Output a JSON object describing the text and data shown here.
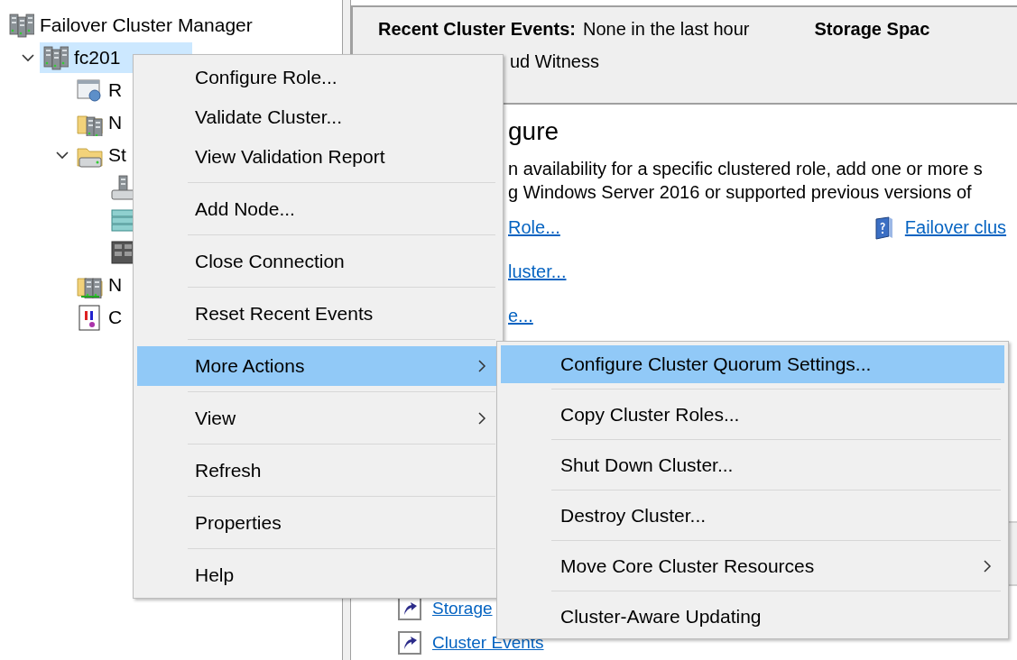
{
  "tree": {
    "items": [
      {
        "label": "Failover Cluster Manager",
        "kind": "manager",
        "selected": false,
        "children": [
          {
            "label": "fc201",
            "kind": "cluster",
            "selected": true,
            "expanded": true,
            "children": [
              {
                "label": "R",
                "kind": "roles",
                "selected": false
              },
              {
                "label": "N",
                "kind": "nodes",
                "selected": false
              },
              {
                "label": "St",
                "kind": "storage",
                "selected": false,
                "expanded": true,
                "children": [
                  {
                    "kind": "disks",
                    "selected": false
                  },
                  {
                    "kind": "pools",
                    "selected": false
                  },
                  {
                    "kind": "enclosures",
                    "selected": false
                  }
                ]
              },
              {
                "label": "N",
                "kind": "networks",
                "selected": false
              },
              {
                "label": "C",
                "kind": "events",
                "selected": false
              }
            ]
          }
        ]
      }
    ]
  },
  "summary": {
    "events_label": "Recent Cluster Events:",
    "events_value": "None in the last hour",
    "storage_label": "Storage Spac",
    "witness_value": "ud Witness"
  },
  "configure": {
    "heading": "gure",
    "lines": [
      "n availability for a specific clustered role, add one or more s",
      "g Windows Server 2016 or supported previous versions of"
    ],
    "links": [
      "Role...",
      "luster...",
      "e..."
    ],
    "help_link": "Failover clus"
  },
  "navigate_links": [
    "Storage",
    "Cluster Events"
  ],
  "context_menu": {
    "groups": [
      [
        {
          "label": "Configure Role...",
          "selected": false
        },
        {
          "label": "Validate Cluster...",
          "selected": false
        },
        {
          "label": "View Validation Report",
          "selected": false
        }
      ],
      [
        {
          "label": "Add Node...",
          "selected": false
        }
      ],
      [
        {
          "label": "Close Connection",
          "selected": false
        }
      ],
      [
        {
          "label": "Reset Recent Events",
          "selected": false
        }
      ],
      [
        {
          "label": "More Actions",
          "selected": true,
          "submenu": true
        }
      ],
      [
        {
          "label": "View",
          "selected": false,
          "submenu": true
        }
      ],
      [
        {
          "label": "Refresh",
          "selected": false
        }
      ],
      [
        {
          "label": "Properties",
          "selected": false
        }
      ],
      [
        {
          "label": "Help",
          "selected": false
        }
      ]
    ]
  },
  "submenu": {
    "groups": [
      [
        {
          "label": "Configure Cluster Quorum Settings...",
          "selected": true
        }
      ],
      [
        {
          "label": "Copy Cluster Roles...",
          "selected": false
        }
      ],
      [
        {
          "label": "Shut Down Cluster...",
          "selected": false
        }
      ],
      [
        {
          "label": "Destroy Cluster...",
          "selected": false
        }
      ],
      [
        {
          "label": "Move Core Cluster Resources",
          "selected": false,
          "submenu": true
        }
      ],
      [
        {
          "label": "Cluster-Aware Updating",
          "selected": false
        }
      ]
    ]
  }
}
